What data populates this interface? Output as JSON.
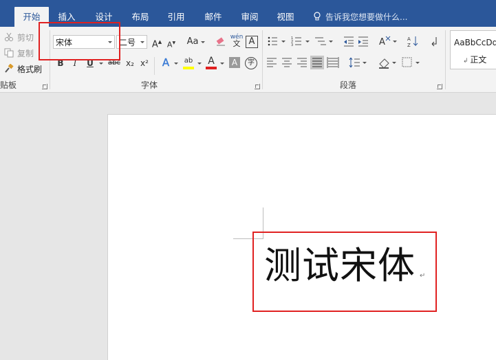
{
  "tabs": [
    {
      "label": "开始",
      "active": true
    },
    {
      "label": "插入"
    },
    {
      "label": "设计"
    },
    {
      "label": "布局"
    },
    {
      "label": "引用"
    },
    {
      "label": "邮件"
    },
    {
      "label": "审阅"
    },
    {
      "label": "视图"
    }
  ],
  "tell_me": "告诉我您想要做什么...",
  "clipboard": {
    "cut": "剪切",
    "copy": "复制",
    "format_painter": "格式刷",
    "group_label": "贴板"
  },
  "font": {
    "font_name": "宋体",
    "font_size": "二号",
    "grow": "A",
    "shrink": "A",
    "change_case": "Aa",
    "phonetic_top": "wén",
    "phonetic_bottom": "文",
    "char_border": "A",
    "bold": "B",
    "italic": "I",
    "underline": "U",
    "strikethrough": "abc",
    "subscript": "x₂",
    "superscript": "x²",
    "highlight": "ab",
    "font_color": "A",
    "char_shading": "A",
    "enclose": "字",
    "group_label": "字体"
  },
  "paragraph": {
    "group_label": "段落"
  },
  "styles": {
    "preview": "AaBbCcDd",
    "normal": "正文"
  },
  "document": {
    "text": "测试宋体",
    "mark": "↵"
  },
  "colors": {
    "tabbar": "#2b579a",
    "highlight_box": "#e02020",
    "highlight_yellow": "#ffff00",
    "font_red": "#e02020"
  }
}
